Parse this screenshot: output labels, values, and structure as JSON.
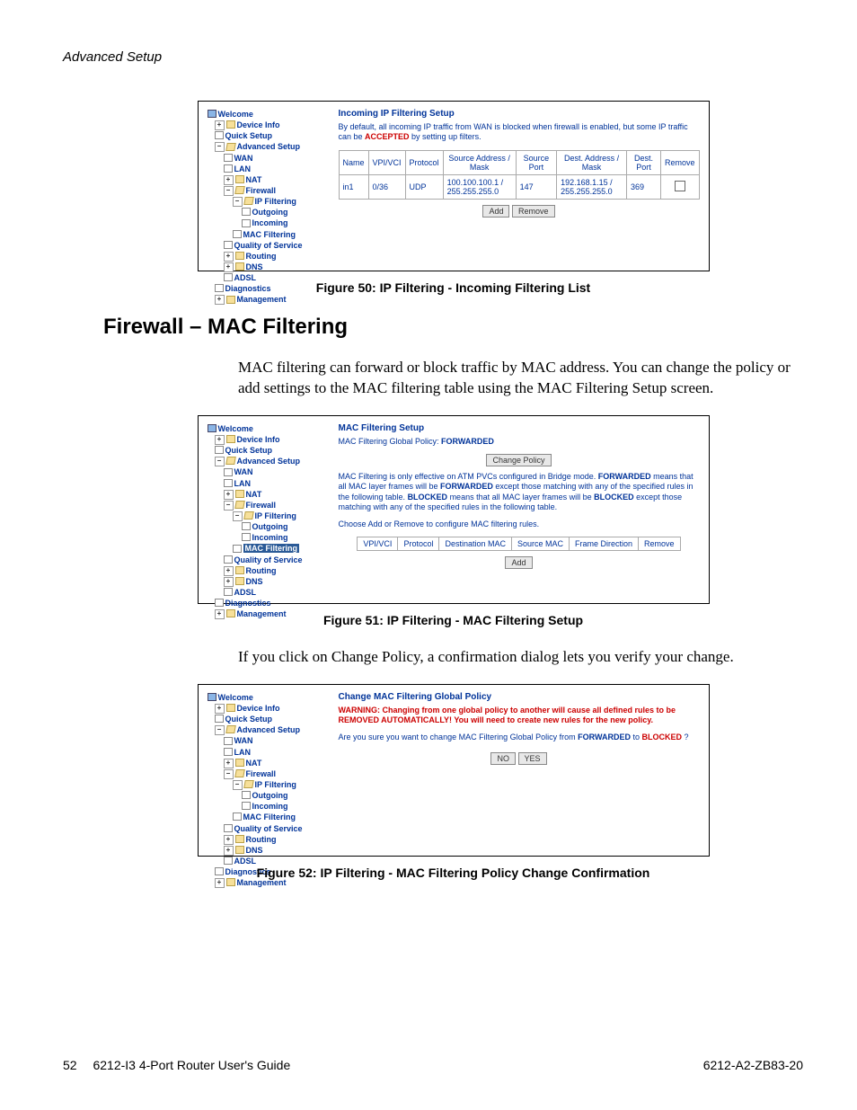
{
  "header": {
    "section": "Advanced Setup"
  },
  "figures": {
    "f50": {
      "caption": "Figure 50: IP Filtering - Incoming Filtering List",
      "title": "Incoming IP Filtering Setup",
      "subtitle_a": "By default, all incoming IP traffic from WAN is blocked when firewall is enabled, but some IP traffic can be ",
      "subtitle_accepted": "ACCEPTED",
      "subtitle_b": " by setting up filters.",
      "headers": [
        "Name",
        "VPI/VCI",
        "Protocol",
        "Source Address / Mask",
        "Source Port",
        "Dest. Address / Mask",
        "Dest. Port",
        "Remove"
      ],
      "row": {
        "name": "in1",
        "vpi_vci": "0/36",
        "protocol": "UDP",
        "src_addr_a": "100.100.100.1 /",
        "src_addr_b": "255.255.255.0",
        "src_port": "147",
        "dst_addr_a": "192.168.1.15 /",
        "dst_addr_b": "255.255.255.0",
        "dst_port": "369"
      },
      "btn_add": "Add",
      "btn_remove": "Remove"
    },
    "f51": {
      "caption": "Figure 51: IP Filtering - MAC Filtering Setup",
      "title": "MAC Filtering Setup",
      "policy_a": "MAC Filtering Global Policy: ",
      "policy_b": "FORWARDED",
      "btn_change": "Change Policy",
      "desc_a": "MAC Filtering is only effective on ATM PVCs configured in Bridge mode. ",
      "desc_fwd": "FORWARDED",
      "desc_b": " means that all MAC layer frames will be ",
      "desc_c": " except those matching with any of the specified rules in the following table. ",
      "desc_blk": "BLOCKED",
      "desc_d": " means that all MAC layer frames will be ",
      "desc_e": " except those matching with any of the specified rules in the following table.",
      "choose": "Choose Add or Remove to configure MAC filtering rules.",
      "headers": [
        "VPI/VCI",
        "Protocol",
        "Destination MAC",
        "Source MAC",
        "Frame Direction",
        "Remove"
      ],
      "btn_add": "Add"
    },
    "f52": {
      "caption": "Figure 52: IP Filtering - MAC Filtering Policy Change Confirmation",
      "title": "Change MAC Filtering Global Policy",
      "warn_a": "WARNING: Changing from one global policy to another will cause all defined rules to be REMOVED AUTOMATICALLY! You will need to create new rules for the new policy.",
      "ask_a": "Are you sure you want to change MAC Filtering Global Policy from ",
      "ask_fwd": "FORWARDED",
      "ask_mid": " to ",
      "ask_blk": "BLOCKED",
      "ask_q": " ?",
      "btn_no": "NO",
      "btn_yes": "YES"
    }
  },
  "tree": {
    "welcome": "Welcome",
    "device_info": "Device Info",
    "quick_setup": "Quick Setup",
    "advanced_setup": "Advanced Setup",
    "wan": "WAN",
    "lan": "LAN",
    "nat": "NAT",
    "firewall": "Firewall",
    "ip_filtering": "IP Filtering",
    "outgoing": "Outgoing",
    "incoming": "Incoming",
    "mac_filtering": "MAC Filtering",
    "qos": "Quality of Service",
    "routing": "Routing",
    "dns": "DNS",
    "adsl": "ADSL",
    "diagnostics": "Diagnostics",
    "management": "Management"
  },
  "section": {
    "h2": "Firewall – MAC Filtering",
    "p1": "MAC filtering can forward or block traffic by MAC address. You can change the policy or add settings to the MAC filtering table using the MAC Filtering Setup screen.",
    "p2": "If you click on Change Policy, a confirmation dialog lets you verify your change."
  },
  "footer": {
    "page": "52",
    "guide": "6212-I3 4-Port Router User's Guide",
    "doc": "6212-A2-ZB83-20"
  }
}
